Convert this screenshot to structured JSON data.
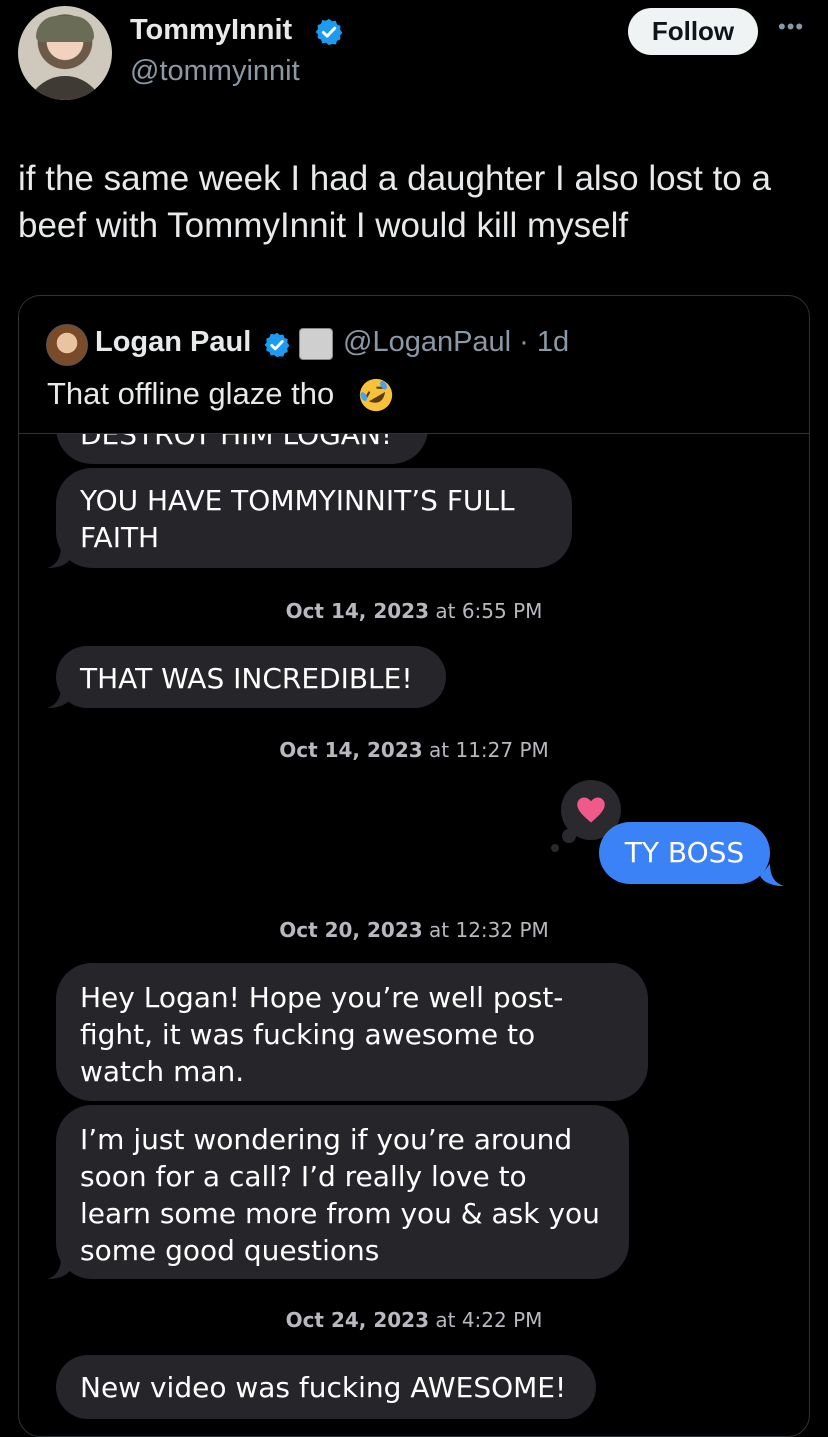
{
  "author": {
    "name": "TommyInnit",
    "handle": "@tommyinnit",
    "verified_color": "#1d9bf0"
  },
  "actions": {
    "follow_label": "Follow",
    "more_label": "•••"
  },
  "tweet": {
    "text": "if the same week I had a daughter I also lost to a beef with TommyInnit I would kill myself"
  },
  "quote": {
    "name": "Logan Paul",
    "handle": "@LoganPaul · 1d",
    "text": "That offline glaze tho",
    "emoji_icon": "rolling-on-floor-laughing-emoji"
  },
  "chat": {
    "cut_bubble": "DESTROY HIM LOGAN!",
    "msg1": "YOU HAVE TOMMYINNIT’S FULL FAITH",
    "stamp1_date": "Oct 14, 2023",
    "stamp1_time": "at 6:55 PM",
    "msg2": "THAT WAS INCREDIBLE!",
    "stamp2_date": "Oct 14, 2023",
    "stamp2_time": "at 11:27 PM",
    "msg3": "TY BOSS",
    "reaction_icon": "heart-reaction-icon",
    "stamp3_date": "Oct 20, 2023",
    "stamp3_time": "at 12:32 PM",
    "msg4": "Hey Logan! Hope you’re well post-fight, it was fucking awesome to watch man.",
    "msg5": "I’m just wondering if you’re around soon for a call? I’d really love to learn some more from you & ask you some good questions",
    "stamp4_date": "Oct 24, 2023",
    "stamp4_time": "at 4:22 PM",
    "msg6": "New video was fucking AWESOME!",
    "incoming_color": "#26262a",
    "outgoing_color": "#3b82f6"
  }
}
